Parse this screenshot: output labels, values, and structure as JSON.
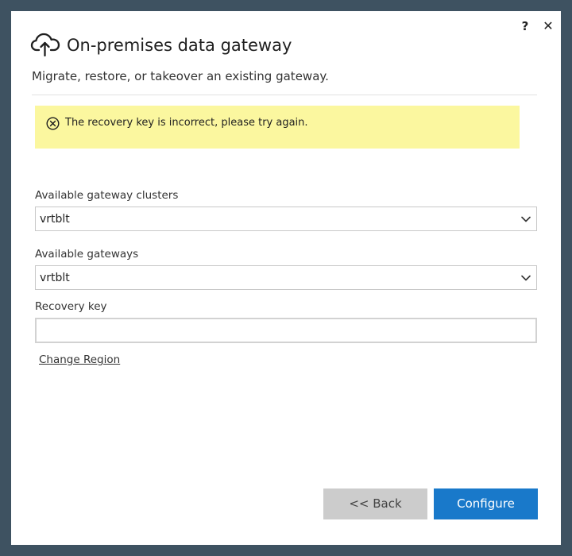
{
  "window": {
    "title": "On-premises data gateway",
    "subtitle": "Migrate, restore, or takeover an existing gateway.",
    "help_label": "?",
    "close_label": "✕"
  },
  "error": {
    "message": "The recovery key is incorrect, please try again."
  },
  "form": {
    "clusters": {
      "label": "Available gateway clusters",
      "value": "vrtblt"
    },
    "gateways": {
      "label": "Available gateways",
      "value": "vrtblt"
    },
    "recovery_key": {
      "label": "Recovery key",
      "value": ""
    },
    "change_region_label": "Change Region"
  },
  "buttons": {
    "back_label": "<< Back",
    "configure_label": "Configure"
  },
  "colors": {
    "accent": "#1979ca",
    "error_banner": "#fbf79f",
    "frame": "#3e5261"
  },
  "icons": {
    "header": "cloud-upload-icon",
    "error": "error-circle-x-icon",
    "dropdown": "chevron-down-icon"
  }
}
